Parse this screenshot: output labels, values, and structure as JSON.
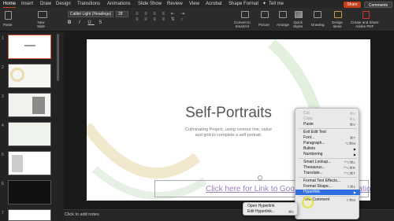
{
  "tabs": [
    "Home",
    "Insert",
    "Draw",
    "Design",
    "Transitions",
    "Animations",
    "Slide Show",
    "Review",
    "View",
    "Acrobat",
    "Shape Format",
    "Tell me"
  ],
  "top_right": {
    "share": "Share",
    "comments": "Comments"
  },
  "ribbon": {
    "paste": "Paste",
    "new_slide": "New\nSlide",
    "font_name": "Calibri Light (Headings)",
    "font_size": "28",
    "convert_smartart": "Convert to\nSmartArt",
    "picture": "Picture",
    "arrange": "Arrange",
    "quick_styles": "Quick\nStyles",
    "drawing": "Drawing",
    "design_ideas": "Design\nIdeas",
    "create_share_pdf": "Create and Share\nAdobe PDF"
  },
  "slides": [
    "1",
    "2",
    "3",
    "4",
    "5",
    "6",
    "7"
  ],
  "slide": {
    "title": "Self-Portraits",
    "subtitle_line1": "Culminating Project, using contour line, value",
    "subtitle_line2": "and grid to complete a self portrait.",
    "link_text": "Click here for Link to Google Slides Presentation"
  },
  "notes": "Click to add notes",
  "context_menu": [
    {
      "label": "Cut",
      "shortcut": "⌘X",
      "disabled": true
    },
    {
      "label": "Copy",
      "shortcut": "⌘C",
      "disabled": true
    },
    {
      "label": "Paste",
      "shortcut": "⌘V",
      "disabled": false
    },
    {
      "sep": true
    },
    {
      "label": "Exit Edit Text",
      "shortcut": "",
      "disabled": false
    },
    {
      "label": "Font...",
      "shortcut": "⌘T",
      "disabled": false
    },
    {
      "label": "Paragraph...",
      "shortcut": "⌥⌘M",
      "disabled": false
    },
    {
      "label": "Bullets",
      "shortcut": "",
      "arrow": true,
      "disabled": false
    },
    {
      "label": "Numbering",
      "shortcut": "",
      "arrow": true,
      "disabled": false
    },
    {
      "sep": true
    },
    {
      "label": "Smart Lookup...",
      "shortcut": "^⌥⌘L",
      "disabled": false
    },
    {
      "label": "Thesaurus...",
      "shortcut": "^⌥⌘R",
      "disabled": false
    },
    {
      "label": "Translate...",
      "shortcut": "^⌥⌘T",
      "disabled": false
    },
    {
      "sep": true
    },
    {
      "label": "Format Text Effects...",
      "shortcut": "",
      "disabled": false
    },
    {
      "label": "Format Shape...",
      "shortcut": "⇧⌘1",
      "disabled": false
    },
    {
      "label": "Hyperlink",
      "shortcut": "",
      "arrow": true,
      "disabled": false,
      "highlighted": true
    },
    {
      "sep": true
    },
    {
      "label": "New Comment",
      "shortcut": "⇧⌘M",
      "disabled": false
    }
  ],
  "submenu": [
    {
      "label": "Open Hyperlink",
      "shortcut": ""
    },
    {
      "label": "Edit Hyperlink...",
      "shortcut": "⌘K"
    }
  ],
  "colors": {
    "accent": "#c43e1c",
    "link": "#9a7fbf",
    "highlight": "#2f6fe0"
  }
}
